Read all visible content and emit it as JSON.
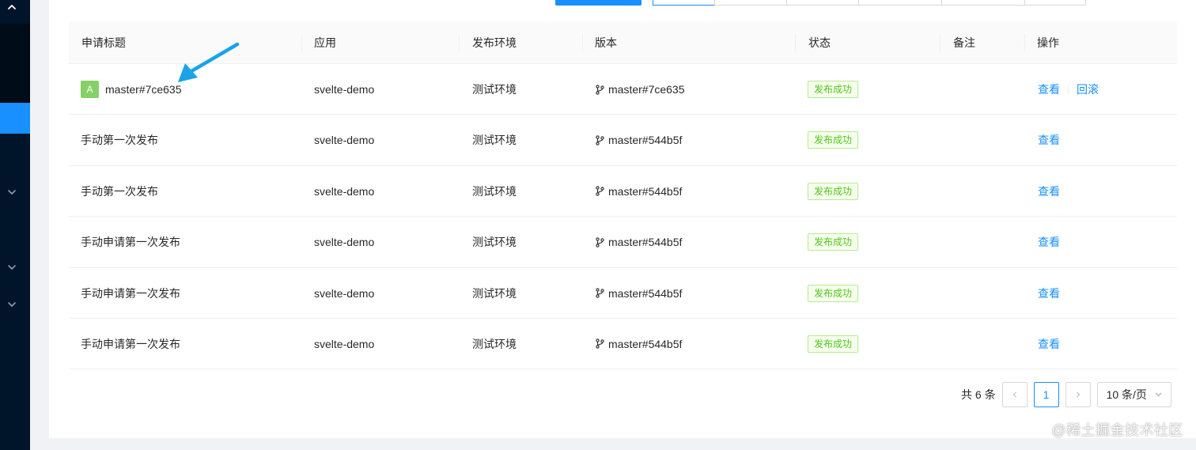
{
  "table": {
    "headers": [
      "申请标题",
      "应用",
      "发布环境",
      "版本",
      "状态",
      "备注",
      "操作"
    ],
    "rows": [
      {
        "avatar": "A",
        "title": "master#7ce635",
        "app": "svelte-demo",
        "env": "测试环境",
        "version": "master#7ce635",
        "status": "发布成功",
        "note": "",
        "view": "查看",
        "rollback": "回滚"
      },
      {
        "avatar": "",
        "title": "手动第一次发布",
        "app": "svelte-demo",
        "env": "测试环境",
        "version": "master#544b5f",
        "status": "发布成功",
        "note": "",
        "view": "查看",
        "rollback": ""
      },
      {
        "avatar": "",
        "title": "手动第一次发布",
        "app": "svelte-demo",
        "env": "测试环境",
        "version": "master#544b5f",
        "status": "发布成功",
        "note": "",
        "view": "查看",
        "rollback": ""
      },
      {
        "avatar": "",
        "title": "手动申请第一次发布",
        "app": "svelte-demo",
        "env": "测试环境",
        "version": "master#544b5f",
        "status": "发布成功",
        "note": "",
        "view": "查看",
        "rollback": ""
      },
      {
        "avatar": "",
        "title": "手动申请第一次发布",
        "app": "svelte-demo",
        "env": "测试环境",
        "version": "master#544b5f",
        "status": "发布成功",
        "note": "",
        "view": "查看",
        "rollback": ""
      },
      {
        "avatar": "",
        "title": "手动申请第一次发布",
        "app": "svelte-demo",
        "env": "测试环境",
        "version": "master#544b5f",
        "status": "发布成功",
        "note": "",
        "view": "查看",
        "rollback": ""
      }
    ]
  },
  "pagination": {
    "total": "共 6 条",
    "current": "1",
    "page_size": "10 条/页"
  },
  "watermark": "@稀土掘金技术社区",
  "colors": {
    "primary": "#1890ff",
    "success": "#52c41a",
    "sidebar": "#001529",
    "avatar": "#87d068",
    "annotation_arrow": "#1aa3e8"
  },
  "icons": {
    "branch": "branch-icon",
    "prev": "chevron-left-icon",
    "next": "chevron-right-icon",
    "size_dropdown": "chevron-down-icon",
    "sidebar_collapse": "chevron-up-icon",
    "sidebar_expand": "chevron-down-icon"
  }
}
